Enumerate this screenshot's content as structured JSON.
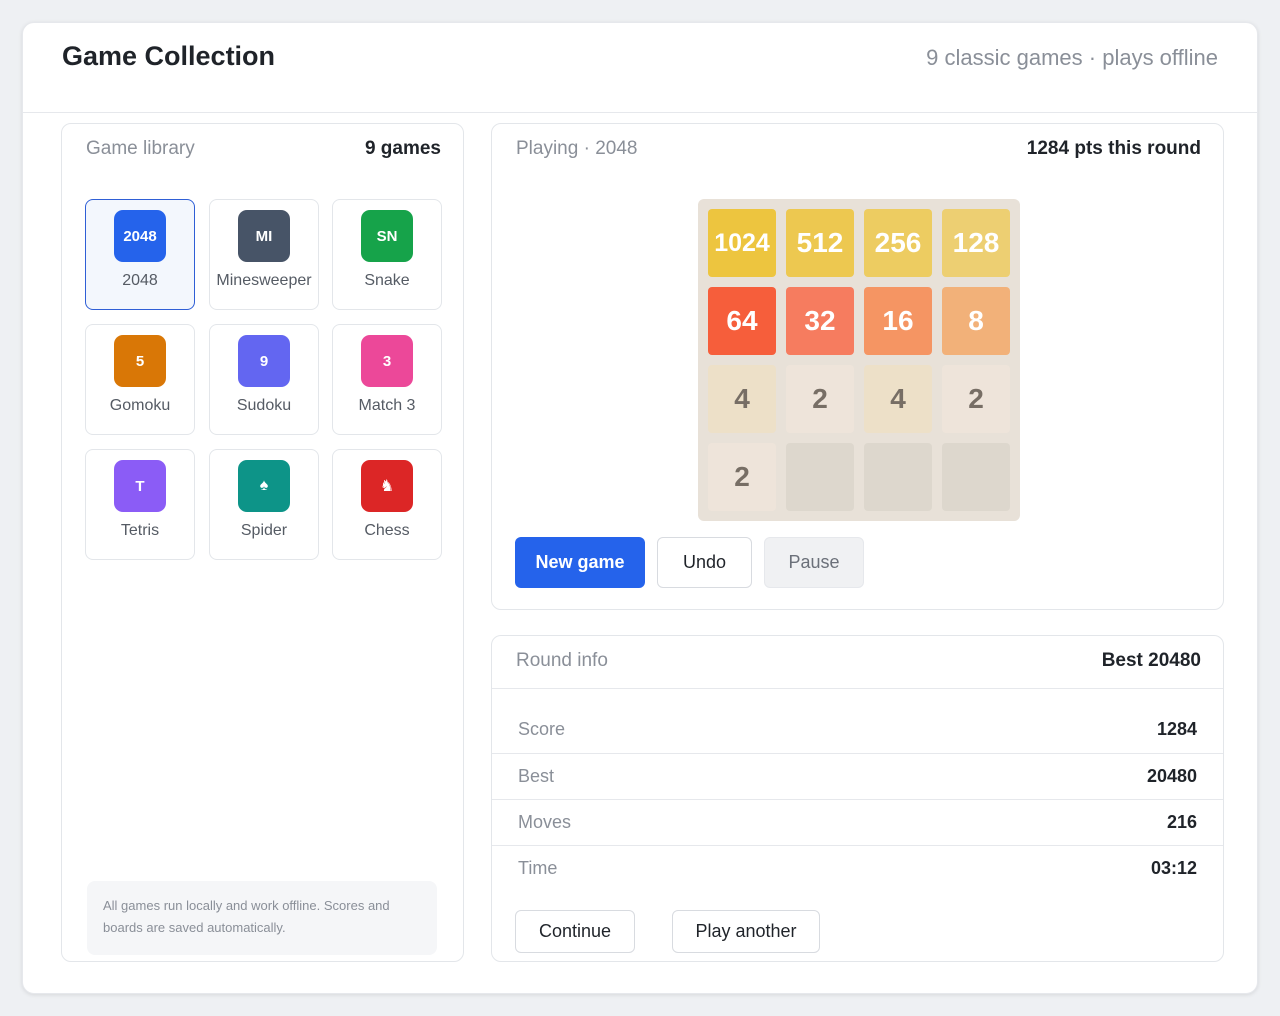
{
  "header": {
    "title": "Game Collection",
    "subtitle": "9 classic games · plays offline"
  },
  "library": {
    "title": "Game library",
    "count": "9 games",
    "games": [
      {
        "icon_text": "2048",
        "label": "2048",
        "color": "#2563eb",
        "active": true
      },
      {
        "icon_text": "MI",
        "label": "Minesweeper",
        "color": "#475467"
      },
      {
        "icon_text": "SN",
        "label": "Snake",
        "color": "#16a34a"
      },
      {
        "icon_text": "5",
        "label": "Gomoku",
        "color": "#d97706"
      },
      {
        "icon_text": "9",
        "label": "Sudoku",
        "color": "#6366f1"
      },
      {
        "icon_text": "3",
        "label": "Match 3",
        "color": "#ec4899"
      },
      {
        "icon_text": "T",
        "label": "Tetris",
        "color": "#8b5cf6"
      },
      {
        "icon_text": "♠",
        "label": "Spider",
        "color": "#0d9488"
      },
      {
        "icon_text": "♞",
        "label": "Chess",
        "color": "#dc2626"
      }
    ],
    "note": "All games run locally and work offline. Scores and boards are saved automatically."
  },
  "game": {
    "title": "Playing · 2048",
    "round_points": "1284 pts this round",
    "board": [
      [
        "1024",
        "512",
        "256",
        "128"
      ],
      [
        "64",
        "32",
        "16",
        "8"
      ],
      [
        "4",
        "2",
        "4",
        "2"
      ],
      [
        "2",
        "",
        "",
        ""
      ]
    ],
    "buttons": {
      "new_game": "New game",
      "undo": "Undo",
      "pause": "Pause"
    }
  },
  "round": {
    "title": "Round info",
    "best_header": "Best 20480",
    "stats": [
      {
        "label": "Score",
        "value": "1284"
      },
      {
        "label": "Best",
        "value": "20480"
      },
      {
        "label": "Moves",
        "value": "216"
      },
      {
        "label": "Time",
        "value": "03:12"
      }
    ],
    "buttons": {
      "continue": "Continue",
      "play_another": "Play another"
    }
  }
}
